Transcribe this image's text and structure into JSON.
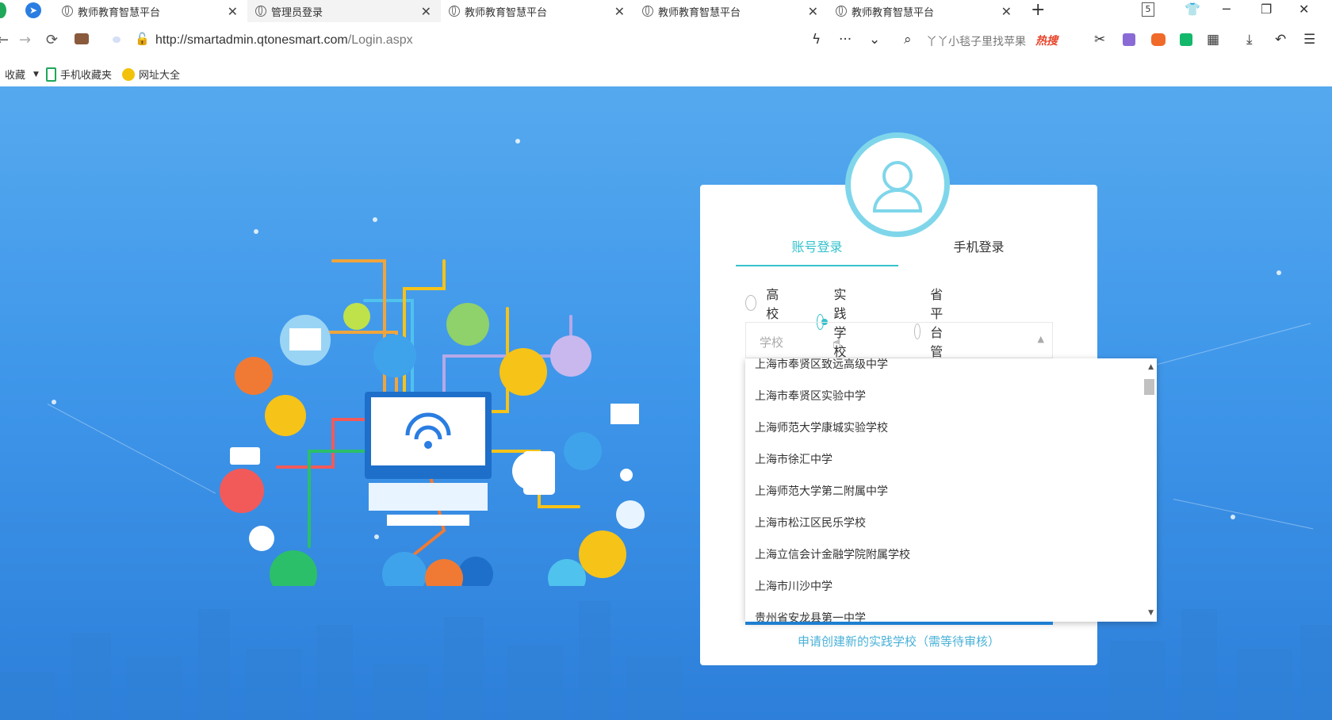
{
  "tabs": [
    {
      "label": "教师教育智慧平台",
      "active": false
    },
    {
      "label": "管理员登录",
      "active": true
    },
    {
      "label": "教师教育智慧平台",
      "active": false
    },
    {
      "label": "教师教育智慧平台",
      "active": false
    },
    {
      "label": "教师教育智慧平台",
      "active": false
    }
  ],
  "address": {
    "host": "http://smartadmin.qtonesmart.com",
    "path": "/Login.aspx",
    "search_hint": "丫丫小毯子里找苹果",
    "hot_label": "热搜"
  },
  "window": {
    "tab_count": "5"
  },
  "bookmarks": {
    "favorites": "收藏",
    "mobile": "手机收藏夹",
    "sites": "网址大全"
  },
  "login": {
    "tab_account": "账号登录",
    "tab_phone": "手机登录",
    "radio_options": [
      "高校",
      "实践学校",
      "省平台管理"
    ],
    "selected_radio": "实践学校",
    "school_placeholder": "学校",
    "school_options": [
      "上海市奉贤区致远高级中学",
      "上海市奉贤区实验中学",
      "上海师范大学康城实验学校",
      "上海市徐汇中学",
      "上海师范大学第二附属中学",
      "上海市松江区民乐学校",
      "上海立信会计金融学院附属学校",
      "上海市川沙中学",
      "贵州省安龙县第一中学"
    ],
    "apply_link": "申请创建新的实践学校（需等待审核）"
  },
  "colors": {
    "accent": "#35c2cc",
    "link": "#4ab1d8",
    "bg_blue": "#3f97ea"
  }
}
